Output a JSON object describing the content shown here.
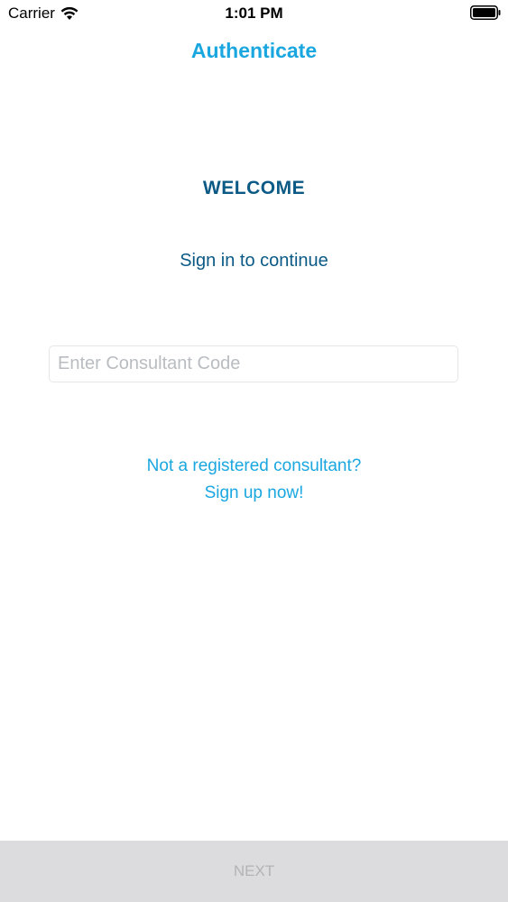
{
  "status_bar": {
    "carrier": "Carrier",
    "time": "1:01 PM",
    "wifi_icon": "wifi-icon",
    "battery_icon": "battery-icon"
  },
  "nav": {
    "title": "Authenticate"
  },
  "main": {
    "heading": "WELCOME",
    "subtitle": "Sign in to continue",
    "code_input": {
      "value": "",
      "placeholder": "Enter Consultant Code"
    },
    "signup_prompt": "Not a registered consultant?",
    "signup_link": "Sign up now!"
  },
  "footer": {
    "next_label": "NEXT"
  },
  "colors": {
    "accent": "#1aa7e0",
    "heading": "#0b5a86",
    "next_bg": "#dcdcde",
    "next_text": "#b3b3b6"
  }
}
